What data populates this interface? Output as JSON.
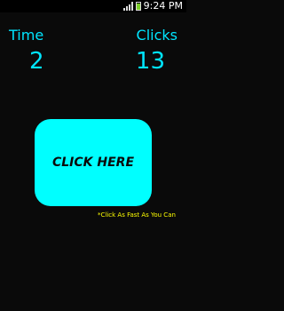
{
  "status_bar": {
    "time": "9:24 PM",
    "icons": [
      "signal-icon",
      "battery-icon"
    ],
    "battery_color": "#7ecf2b"
  },
  "scoreboard": {
    "time_label": "Time",
    "time_value": "2",
    "clicks_label": "Clicks",
    "clicks_value": "13",
    "color": "#00e5ff"
  },
  "main": {
    "button_label": "CLICK HERE",
    "button_color": "#00ffff",
    "hint_text": "*Click As Fast As You Can",
    "hint_color": "#ffff00"
  }
}
